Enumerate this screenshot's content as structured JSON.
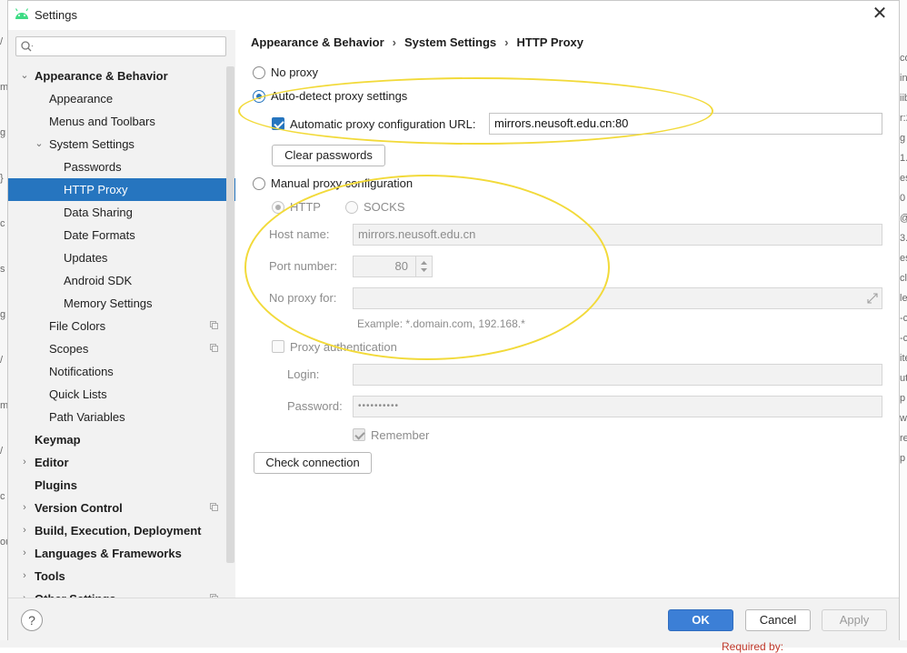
{
  "window": {
    "title": "Settings",
    "close_glyph": "✕"
  },
  "search": {
    "placeholder": ""
  },
  "sidebar": {
    "items": [
      {
        "label": "Appearance & Behavior",
        "level": 0,
        "bold": true,
        "chevron": "⌄",
        "selected": false,
        "proj": false
      },
      {
        "label": "Appearance",
        "level": 1,
        "bold": false,
        "chevron": "",
        "selected": false,
        "proj": false
      },
      {
        "label": "Menus and Toolbars",
        "level": 1,
        "bold": false,
        "chevron": "",
        "selected": false,
        "proj": false
      },
      {
        "label": "System Settings",
        "level": 1,
        "bold": false,
        "chevron": "⌄",
        "selected": false,
        "proj": false
      },
      {
        "label": "Passwords",
        "level": 2,
        "bold": false,
        "chevron": "",
        "selected": false,
        "proj": false
      },
      {
        "label": "HTTP Proxy",
        "level": 2,
        "bold": false,
        "chevron": "",
        "selected": true,
        "proj": false
      },
      {
        "label": "Data Sharing",
        "level": 2,
        "bold": false,
        "chevron": "",
        "selected": false,
        "proj": false
      },
      {
        "label": "Date Formats",
        "level": 2,
        "bold": false,
        "chevron": "",
        "selected": false,
        "proj": false
      },
      {
        "label": "Updates",
        "level": 2,
        "bold": false,
        "chevron": "",
        "selected": false,
        "proj": false
      },
      {
        "label": "Android SDK",
        "level": 2,
        "bold": false,
        "chevron": "",
        "selected": false,
        "proj": false
      },
      {
        "label": "Memory Settings",
        "level": 2,
        "bold": false,
        "chevron": "",
        "selected": false,
        "proj": false
      },
      {
        "label": "File Colors",
        "level": 1,
        "bold": false,
        "chevron": "",
        "selected": false,
        "proj": true
      },
      {
        "label": "Scopes",
        "level": 1,
        "bold": false,
        "chevron": "",
        "selected": false,
        "proj": true
      },
      {
        "label": "Notifications",
        "level": 1,
        "bold": false,
        "chevron": "",
        "selected": false,
        "proj": false
      },
      {
        "label": "Quick Lists",
        "level": 1,
        "bold": false,
        "chevron": "",
        "selected": false,
        "proj": false
      },
      {
        "label": "Path Variables",
        "level": 1,
        "bold": false,
        "chevron": "",
        "selected": false,
        "proj": false
      },
      {
        "label": "Keymap",
        "level": 0,
        "bold": true,
        "chevron": "",
        "selected": false,
        "proj": false
      },
      {
        "label": "Editor",
        "level": 0,
        "bold": true,
        "chevron": "›",
        "selected": false,
        "proj": false
      },
      {
        "label": "Plugins",
        "level": 0,
        "bold": true,
        "chevron": "",
        "selected": false,
        "proj": false
      },
      {
        "label": "Version Control",
        "level": 0,
        "bold": true,
        "chevron": "›",
        "selected": false,
        "proj": true
      },
      {
        "label": "Build, Execution, Deployment",
        "level": 0,
        "bold": true,
        "chevron": "›",
        "selected": false,
        "proj": false
      },
      {
        "label": "Languages & Frameworks",
        "level": 0,
        "bold": true,
        "chevron": "›",
        "selected": false,
        "proj": false
      },
      {
        "label": "Tools",
        "level": 0,
        "bold": true,
        "chevron": "›",
        "selected": false,
        "proj": false
      },
      {
        "label": "Other Settings",
        "level": 0,
        "bold": true,
        "chevron": "›",
        "selected": false,
        "proj": true
      }
    ]
  },
  "breadcrumb": {
    "part1": "Appearance & Behavior",
    "part2": "System Settings",
    "part3": "HTTP Proxy",
    "sep": "›"
  },
  "proxy": {
    "no_proxy_label": "No proxy",
    "auto_detect_label": "Auto-detect proxy settings",
    "auto_config_label": "Automatic proxy configuration URL:",
    "auto_config_url": "mirrors.neusoft.edu.cn:80",
    "clear_passwords": "Clear passwords",
    "manual_label": "Manual proxy configuration",
    "http_label": "HTTP",
    "socks_label": "SOCKS",
    "host_label": "Host name:",
    "host_value": "mirrors.neusoft.edu.cn",
    "port_label": "Port number:",
    "port_value": "80",
    "no_proxy_for_label": "No proxy for:",
    "no_proxy_for_value": "",
    "example": "Example: *.domain.com, 192.168.*",
    "proxy_auth_label": "Proxy authentication",
    "login_label": "Login:",
    "login_value": "",
    "password_label": "Password:",
    "password_value": "••••••••••",
    "remember_label": "Remember",
    "check_connection": "Check connection"
  },
  "footer": {
    "help": "?",
    "ok": "OK",
    "cancel": "Cancel",
    "apply": "Apply"
  },
  "background_fragments": {
    "left": [
      "/",
      "m",
      "g",
      "}",
      "c",
      "s",
      "g",
      "/",
      "m",
      "/",
      "c",
      "ou"
    ],
    "right": [
      "co",
      "in",
      "iib",
      "r:2",
      "g",
      "1.",
      "es",
      "0",
      "@",
      "3.",
      "es",
      "cl",
      "le",
      "-c",
      "-c",
      "ite",
      "ut",
      "p",
      "w",
      "re",
      "p"
    ],
    "bottom_right": "Required by:"
  },
  "colors": {
    "selection": "#2675bf",
    "accent": "#3c7fd6",
    "highlight": "#f2da3a"
  }
}
